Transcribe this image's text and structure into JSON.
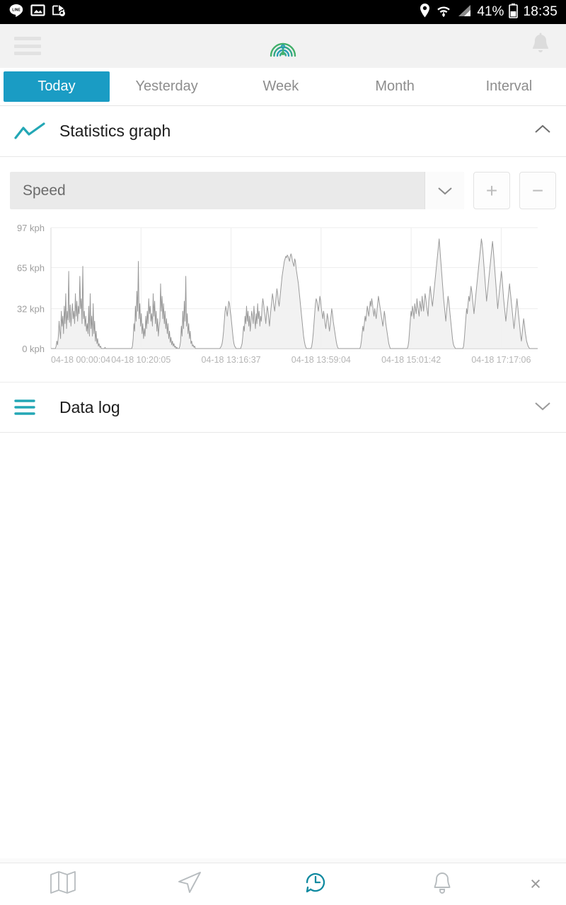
{
  "statusbar": {
    "left_icons": [
      "line-app-icon",
      "photo-icon",
      "screenshot-icon"
    ],
    "right_icons": [
      "location-pin-icon",
      "wifi-icon",
      "signal-bars-icon",
      "battery-icon"
    ],
    "battery_percent": "41%",
    "clock": "18:35"
  },
  "appbar": {
    "menu_icon": "hamburger-menu-icon",
    "logo_icon": "radar-rings-logo",
    "notification_icon": "bell-icon"
  },
  "tabs": [
    {
      "label": "Today",
      "active": true
    },
    {
      "label": "Yesterday",
      "active": false
    },
    {
      "label": "Week",
      "active": false
    },
    {
      "label": "Month",
      "active": false
    },
    {
      "label": "Interval",
      "active": false
    }
  ],
  "statistics_section": {
    "title": "Statistics graph",
    "icon": "line-chart-icon",
    "chevron": "chevron-up-icon",
    "expanded": true
  },
  "controls": {
    "selected_metric": "Speed",
    "dropdown_icon": "chevron-down-icon",
    "zoom_in_label": "+",
    "zoom_out_label": "−"
  },
  "datalog_section": {
    "title": "Data log",
    "icon": "list-lines-icon",
    "chevron": "chevron-down-icon",
    "expanded": false
  },
  "bottom_nav": [
    {
      "name": "map-icon",
      "active": false
    },
    {
      "name": "navigate-arrow-icon",
      "active": false
    },
    {
      "name": "history-clock-icon",
      "active": true
    },
    {
      "name": "bell-icon",
      "active": false
    }
  ],
  "bottom_close": {
    "label": "×",
    "name": "close-icon"
  },
  "colors": {
    "accent_teal": "#1a9cc4",
    "logo_green": "#3fae6e",
    "logo_teal": "#2a9fb5",
    "statusbar_bg": "#000000",
    "appbar_bg": "#f2f2f2",
    "chart_line": "#9a9a9a",
    "chart_fill": "#f0f0f0"
  },
  "chart_data": {
    "type": "area",
    "title": "Speed",
    "xlabel": "",
    "ylabel": "kph",
    "unit": "kph",
    "ylim": [
      0,
      97
    ],
    "grid": true,
    "legend": "none",
    "y_ticks": [
      {
        "value": 97,
        "label": "97 kph"
      },
      {
        "value": 65,
        "label": "65 kph"
      },
      {
        "value": 32,
        "label": "32 kph"
      },
      {
        "value": 0,
        "label": "0 kph"
      }
    ],
    "x_tick_labels": [
      "04-18 00:00:04",
      "04-18 10:20:05",
      "04-18 13:16:37",
      "04-18 13:59:04",
      "04-18 15:01:42",
      "04-18 17:17:06"
    ],
    "x_tick_positions": [
      0.0,
      0.185,
      0.37,
      0.555,
      0.74,
      0.925
    ],
    "series": [
      {
        "name": "Speed",
        "values": [
          0,
          0,
          0,
          0,
          0,
          0,
          0,
          2,
          6,
          3,
          10,
          22,
          14,
          8,
          30,
          18,
          26,
          12,
          34,
          20,
          44,
          16,
          30,
          23,
          62,
          21,
          35,
          18,
          28,
          36,
          24,
          30,
          20,
          44,
          26,
          38,
          22,
          34,
          28,
          58,
          32,
          40,
          20,
          66,
          24,
          30,
          18,
          26,
          14,
          20,
          12,
          34,
          10,
          44,
          16,
          26,
          10,
          36,
          12,
          22,
          6,
          14,
          4,
          8,
          2,
          4,
          1,
          2,
          0,
          0,
          0,
          0,
          0,
          1,
          0,
          0,
          0,
          0,
          0,
          0,
          0,
          0,
          0,
          0,
          0,
          0,
          0,
          0,
          0,
          0,
          0,
          0,
          0,
          0,
          0,
          0,
          0,
          0,
          0,
          0,
          0,
          0,
          0,
          0,
          0,
          0,
          0,
          0,
          0,
          0,
          2,
          8,
          20,
          14,
          34,
          22,
          46,
          30,
          70,
          24,
          36,
          18,
          28,
          12,
          20,
          8,
          16,
          10,
          26,
          16,
          30,
          20,
          40,
          28,
          34,
          22,
          28,
          18,
          44,
          26,
          38,
          20,
          30,
          14,
          24,
          10,
          18,
          22,
          52,
          30,
          42,
          24,
          36,
          20,
          30,
          16,
          24,
          12,
          20,
          8,
          14,
          5,
          9,
          3,
          6,
          2,
          4,
          1,
          2,
          0,
          1,
          0,
          0,
          0,
          2,
          6,
          18,
          10,
          30,
          16,
          38,
          22,
          58,
          18,
          28,
          12,
          20,
          8,
          14,
          4,
          6,
          2,
          3,
          1,
          2,
          0,
          0,
          0,
          0,
          0,
          0,
          0,
          0,
          0,
          0,
          0,
          0,
          0,
          0,
          0,
          0,
          0,
          0,
          0,
          0,
          0,
          0,
          0,
          0,
          0,
          0,
          0,
          0,
          0,
          0,
          0,
          0,
          0,
          0,
          1,
          2,
          4,
          8,
          14,
          22,
          30,
          34,
          30,
          26,
          32,
          38,
          36,
          30,
          26,
          20,
          14,
          8,
          4,
          2,
          1,
          0,
          0,
          0,
          0,
          0,
          0,
          0,
          2,
          4,
          10,
          18,
          14,
          26,
          20,
          34,
          22,
          30,
          18,
          26,
          14,
          22,
          30,
          26,
          20,
          34,
          24,
          16,
          28,
          20,
          36,
          24,
          30,
          18,
          26,
          22,
          34,
          40,
          36,
          30,
          26,
          20,
          28,
          34,
          30,
          24,
          18,
          26,
          32,
          38,
          44,
          40,
          34,
          30,
          36,
          42,
          48,
          44,
          38,
          34,
          40,
          46,
          52,
          58,
          62,
          66,
          70,
          72,
          74,
          73,
          75,
          74,
          72,
          70,
          74,
          76,
          74,
          70,
          68,
          66,
          72,
          70,
          64,
          60,
          56,
          52,
          46,
          40,
          34,
          28,
          22,
          16,
          10,
          6,
          3,
          1,
          0,
          0,
          0,
          0,
          0,
          0,
          0,
          2,
          6,
          12,
          20,
          28,
          36,
          40,
          38,
          34,
          30,
          36,
          42,
          38,
          32,
          28,
          24,
          30,
          26,
          20,
          16,
          22,
          28,
          24,
          18,
          14,
          20,
          26,
          32,
          28,
          22,
          18,
          14,
          10,
          6,
          3,
          1,
          0,
          0,
          0,
          0,
          0,
          0,
          0,
          0,
          0,
          0,
          0,
          0,
          0,
          0,
          0,
          0,
          0,
          0,
          0,
          0,
          0,
          0,
          0,
          0,
          0,
          0,
          0,
          0,
          0,
          0,
          2,
          6,
          12,
          18,
          14,
          20,
          26,
          22,
          28,
          34,
          30,
          26,
          32,
          38,
          34,
          40,
          36,
          30,
          26,
          32,
          28,
          24,
          30,
          36,
          42,
          38,
          34,
          30,
          26,
          22,
          18,
          24,
          30,
          26,
          20,
          16,
          12,
          8,
          4,
          2,
          0,
          0,
          0,
          0,
          0,
          0,
          0,
          0,
          0,
          0,
          0,
          0,
          0,
          0,
          0,
          0,
          0,
          0,
          0,
          0,
          0,
          0,
          0,
          0,
          2,
          6,
          14,
          22,
          30,
          26,
          34,
          30,
          24,
          36,
          32,
          28,
          40,
          34,
          30,
          26,
          38,
          34,
          30,
          42,
          36,
          30,
          38,
          44,
          40,
          34,
          30,
          26,
          38,
          44,
          50,
          44,
          38,
          34,
          40,
          46,
          52,
          58,
          64,
          70,
          76,
          82,
          88,
          80,
          72,
          64,
          56,
          48,
          40,
          34,
          28,
          22,
          30,
          36,
          42,
          38,
          32,
          26,
          20,
          14,
          8,
          4,
          2,
          1,
          0,
          0,
          0,
          0,
          0,
          0,
          0,
          0,
          0,
          0,
          0,
          2,
          8,
          16,
          24,
          32,
          28,
          36,
          42,
          38,
          44,
          50,
          46,
          40,
          34,
          28,
          34,
          40,
          46,
          52,
          58,
          64,
          70,
          76,
          82,
          88,
          84,
          78,
          70,
          62,
          54,
          46,
          38,
          44,
          50,
          56,
          62,
          68,
          74,
          80,
          86,
          80,
          72,
          64,
          56,
          48,
          40,
          32,
          38,
          44,
          50,
          56,
          62,
          56,
          48,
          40,
          34,
          28,
          22,
          28,
          34,
          40,
          46,
          52,
          46,
          40,
          34,
          28,
          22,
          16,
          22,
          28,
          34,
          40,
          34,
          28,
          22,
          16,
          10,
          6,
          12,
          18,
          24,
          20,
          14,
          10,
          6,
          4,
          2,
          1,
          0,
          0,
          0,
          0,
          0,
          0,
          0,
          0,
          0,
          0,
          0,
          0
        ]
      }
    ]
  }
}
